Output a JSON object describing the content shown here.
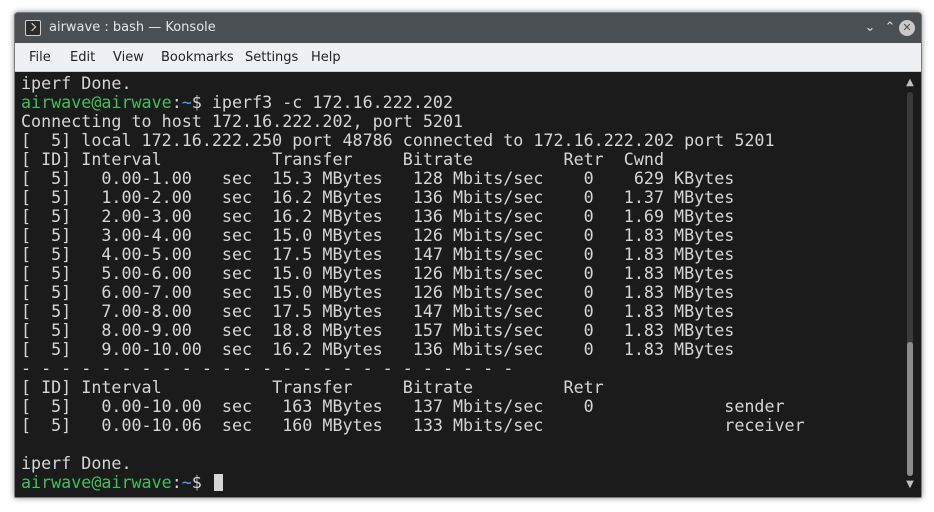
{
  "window": {
    "title": "airwave : bash — Konsole",
    "minimize_glyph": "⌄",
    "maximize_glyph": "⌃",
    "close_glyph": "✕"
  },
  "menubar": {
    "items": [
      "File",
      "Edit",
      "View",
      "Bookmarks",
      "Settings",
      "Help"
    ]
  },
  "terminal": {
    "prompt": {
      "user_host": "airwave@airwave",
      "separator": ":",
      "path": "~",
      "symbol": "$ "
    },
    "lines": [
      {
        "type": "text",
        "text": "iperf Done."
      },
      {
        "type": "prompt",
        "command": "iperf3 -c 172.16.222.202"
      },
      {
        "type": "text",
        "text": "Connecting to host 172.16.222.202, port 5201"
      },
      {
        "type": "text",
        "text": "[  5] local 172.16.222.250 port 48786 connected to 172.16.222.202 port 5201"
      },
      {
        "type": "text",
        "text": "[ ID] Interval           Transfer     Bitrate         Retr  Cwnd"
      },
      {
        "type": "text",
        "text": "[  5]   0.00-1.00   sec  15.3 MBytes   128 Mbits/sec    0    629 KBytes"
      },
      {
        "type": "text",
        "text": "[  5]   1.00-2.00   sec  16.2 MBytes   136 Mbits/sec    0   1.37 MBytes"
      },
      {
        "type": "text",
        "text": "[  5]   2.00-3.00   sec  16.2 MBytes   136 Mbits/sec    0   1.69 MBytes"
      },
      {
        "type": "text",
        "text": "[  5]   3.00-4.00   sec  15.0 MBytes   126 Mbits/sec    0   1.83 MBytes"
      },
      {
        "type": "text",
        "text": "[  5]   4.00-5.00   sec  17.5 MBytes   147 Mbits/sec    0   1.83 MBytes"
      },
      {
        "type": "text",
        "text": "[  5]   5.00-6.00   sec  15.0 MBytes   126 Mbits/sec    0   1.83 MBytes"
      },
      {
        "type": "text",
        "text": "[  5]   6.00-7.00   sec  15.0 MBytes   126 Mbits/sec    0   1.83 MBytes"
      },
      {
        "type": "text",
        "text": "[  5]   7.00-8.00   sec  17.5 MBytes   147 Mbits/sec    0   1.83 MBytes"
      },
      {
        "type": "text",
        "text": "[  5]   8.00-9.00   sec  18.8 MBytes   157 Mbits/sec    0   1.83 MBytes"
      },
      {
        "type": "text",
        "text": "[  5]   9.00-10.00  sec  16.2 MBytes   136 Mbits/sec    0   1.83 MBytes"
      },
      {
        "type": "text",
        "text": "- - - - - - - - - - - - - - - - - - - - - - - - -"
      },
      {
        "type": "text",
        "text": "[ ID] Interval           Transfer     Bitrate         Retr"
      },
      {
        "type": "text",
        "text": "[  5]   0.00-10.00  sec   163 MBytes   137 Mbits/sec    0             sender"
      },
      {
        "type": "text",
        "text": "[  5]   0.00-10.06  sec   160 MBytes   133 Mbits/sec                  receiver"
      },
      {
        "type": "text",
        "text": ""
      },
      {
        "type": "text",
        "text": "iperf Done."
      },
      {
        "type": "prompt",
        "command": "",
        "cursor": true
      }
    ]
  },
  "colors": {
    "prompt_user": "#40c05a",
    "prompt_path": "#4aa3ff",
    "foreground": "#d6d6d6",
    "background": "#1b1b1b"
  },
  "icons": {
    "app": "terminal-icon",
    "scroll_up": "chevron-up-icon",
    "scroll_down": "chevron-down-icon"
  }
}
